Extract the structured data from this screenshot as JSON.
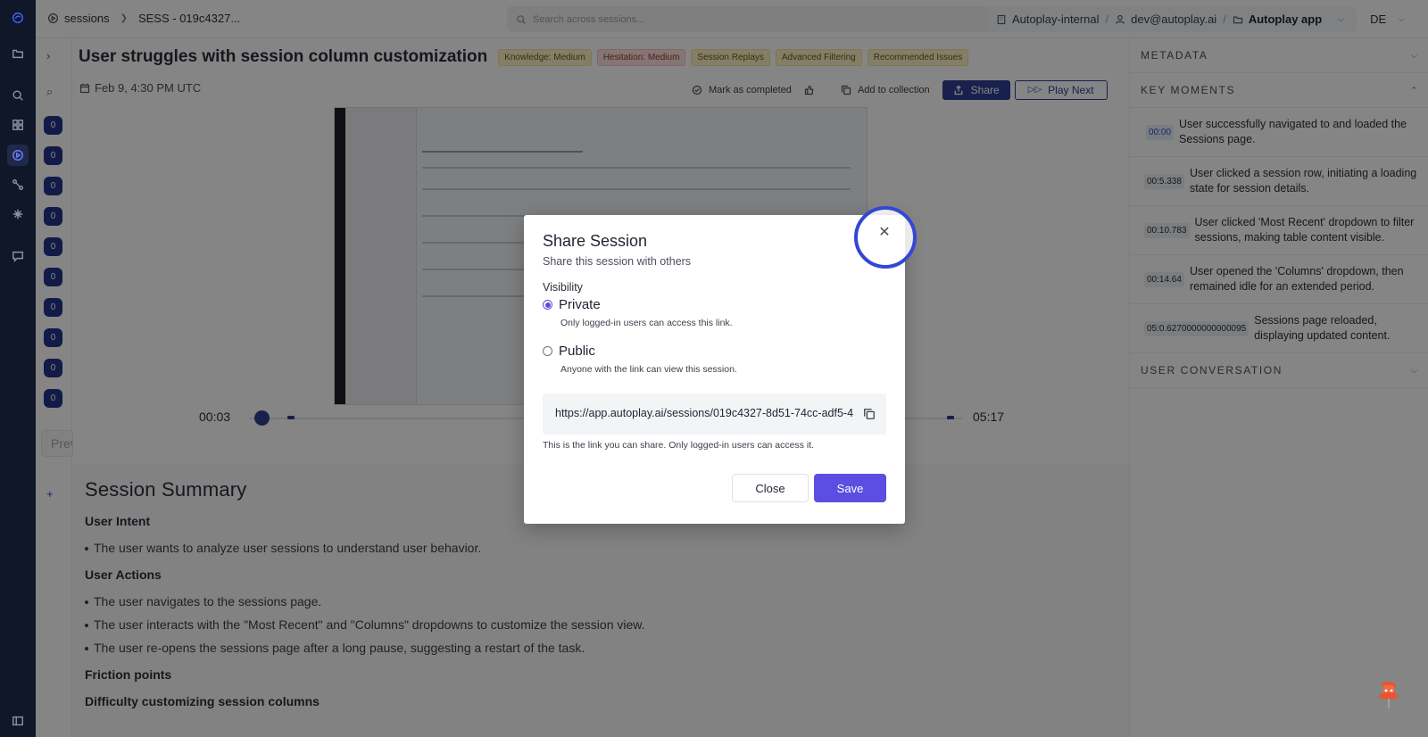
{
  "topbar": {
    "sessions_label": "sessions",
    "session_id": "SESS - 019c4327...",
    "search_placeholder": "Search across sessions...",
    "org": "Autoplay-internal",
    "user": "dev@autoplay.ai",
    "app": "Autoplay app",
    "lang": "DE"
  },
  "sidebar2": {
    "counts": [
      "0",
      "0",
      "0",
      "0",
      "0",
      "0",
      "0",
      "0",
      "0",
      "0"
    ],
    "prev_label": "Previous"
  },
  "page": {
    "title": "User struggles with session column customization",
    "tags": [
      {
        "label": "Knowledge: Medium",
        "tone": "yellow"
      },
      {
        "label": "Hesitation: Medium",
        "tone": "red"
      },
      {
        "label": "Session Replays",
        "tone": "yellow"
      },
      {
        "label": "Advanced Filtering",
        "tone": "yellow"
      },
      {
        "label": "Recommended Issues",
        "tone": "yellow"
      }
    ],
    "date": "Feb 9, 4:30 PM UTC",
    "actions": {
      "mark_completed": "Mark as completed",
      "add_collection": "Add to collection",
      "share": "Share",
      "play_next": "Play Next"
    }
  },
  "player": {
    "current_time": "00:03",
    "total_time": "05:17",
    "progress": 0.01
  },
  "summary": {
    "title": "Session Summary",
    "intent_heading": "User Intent",
    "intent_items": [
      "The user wants to analyze user sessions to understand user behavior."
    ],
    "actions_heading": "User Actions",
    "action_items": [
      "The user navigates to the sessions page.",
      "The user interacts with the \"Most Recent\" and \"Columns\" dropdowns to customize the session view.",
      "The user re-opens the sessions page after a long pause, suggesting a restart of the task."
    ],
    "friction_heading": "Friction points",
    "friction_sub": "Difficulty customizing session columns"
  },
  "right_panel": {
    "metadata": "METADATA",
    "key_moments": "KEY MOMENTS",
    "user_conversation": "USER CONVERSATION",
    "moments": [
      {
        "time": "00:00",
        "text": "User successfully navigated to and loaded the Sessions page."
      },
      {
        "time": "00:5.338",
        "text": "User clicked a session row, initiating a loading state for session details."
      },
      {
        "time": "00:10.783",
        "text": "User clicked 'Most Recent' dropdown to filter sessions, making table content visible."
      },
      {
        "time": "00:14.64",
        "text": "User opened the 'Columns' dropdown, then remained idle for an extended period."
      },
      {
        "time": "05:0.6270000000000095",
        "text": "Sessions page reloaded, displaying updated content."
      }
    ]
  },
  "modal": {
    "title": "Share Session",
    "subtitle": "Share this session with others",
    "visibility_label": "Visibility",
    "private_label": "Private",
    "private_desc": "Only logged-in users can access this link.",
    "public_label": "Public",
    "public_desc": "Anyone with the link can view this session.",
    "link": "https://app.autoplay.ai/sessions/019c4327-8d51-74cc-adf5-4",
    "link_note": "This is the link you can share. Only logged-in users can access it.",
    "close_label": "Close",
    "save_label": "Save",
    "selected": "Private"
  },
  "colors": {
    "accent": "#5b4ee0",
    "navy": "#2f3f95",
    "rail": "#0f1729"
  }
}
